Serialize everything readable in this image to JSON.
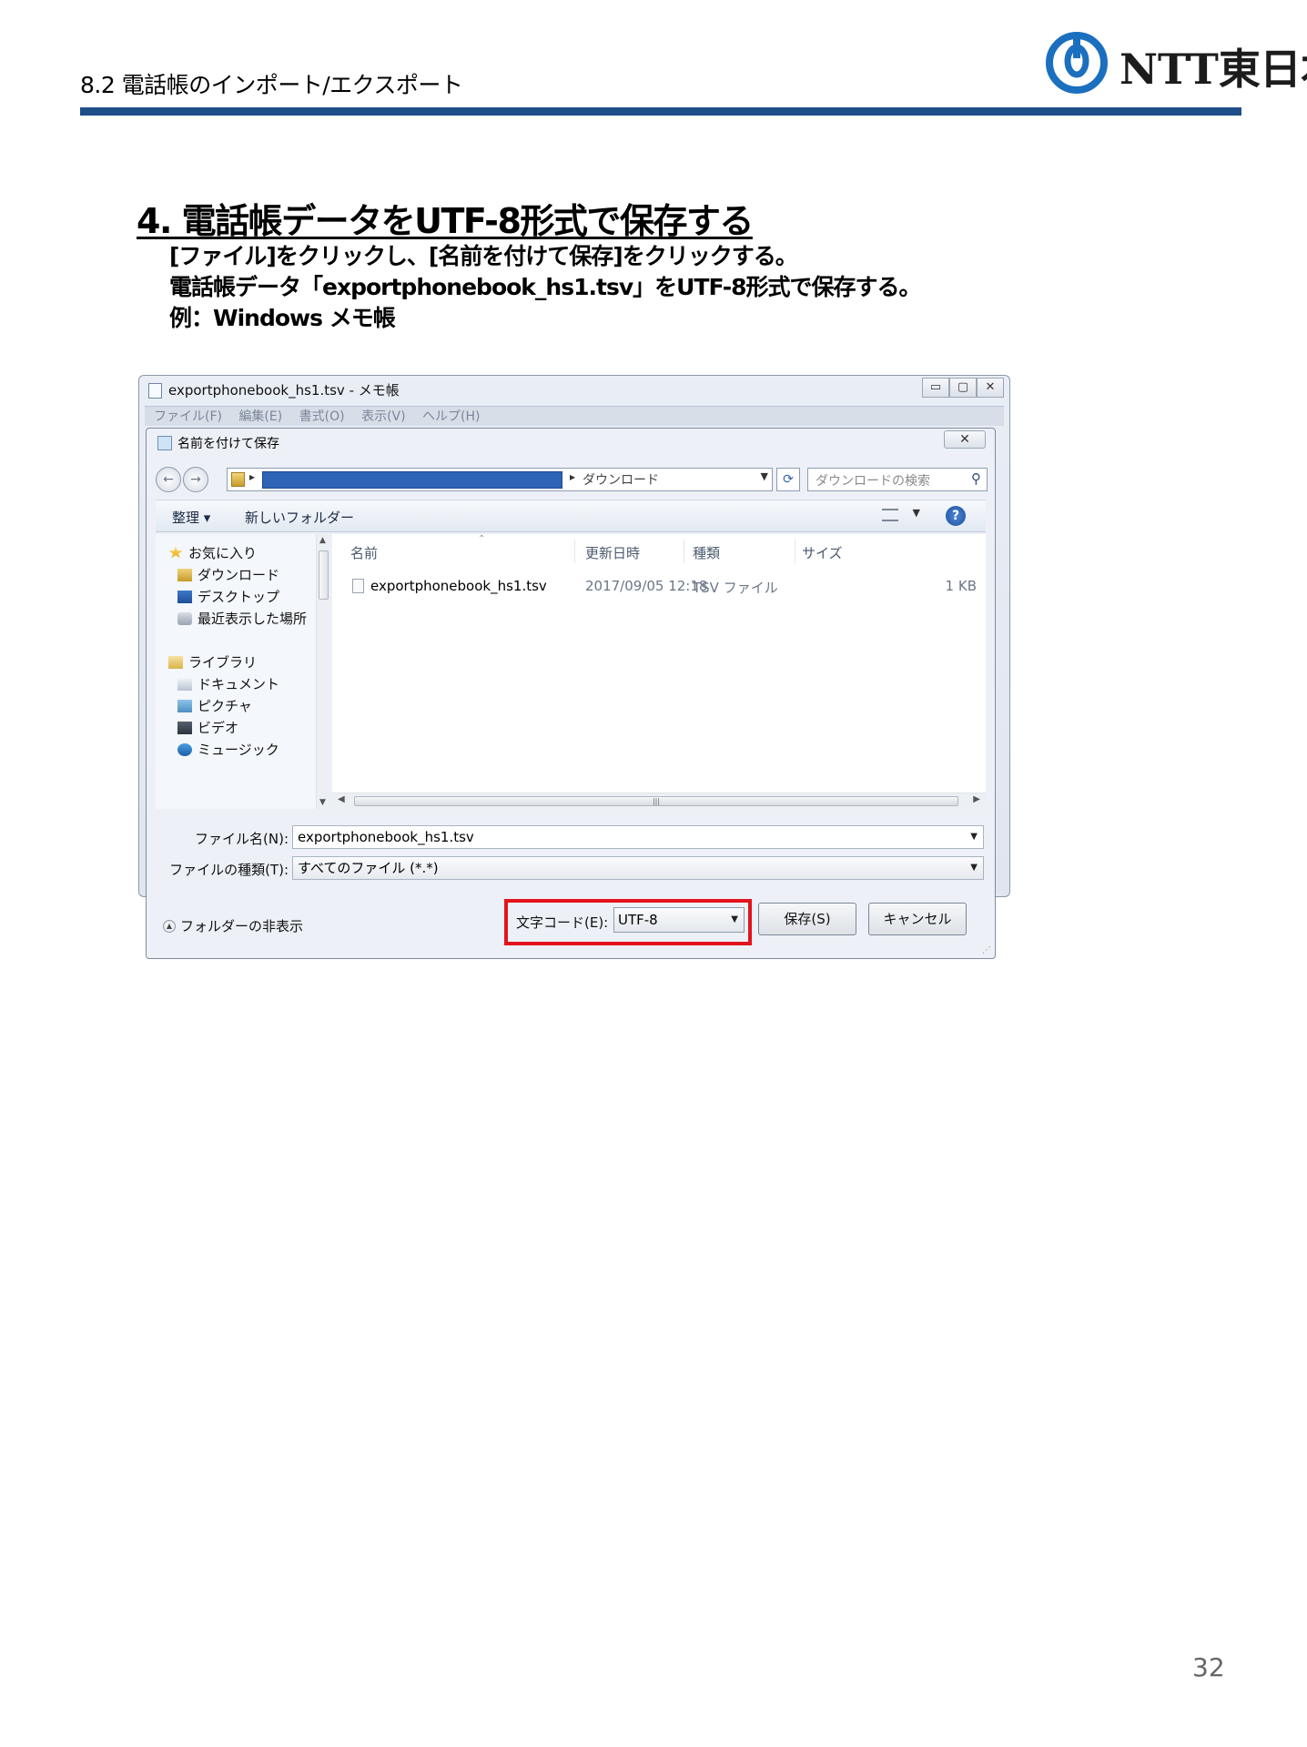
{
  "header": {
    "section_title": "8.2 電話帳のインポート/エクスポート",
    "logo_text_latin": "NTT",
    "logo_text_jp": "東日本",
    "bar_color": "#1f4e89"
  },
  "step": {
    "heading": "4. 電話帳データをUTF-8形式で保存する",
    "line1": "[ファイル]をクリックし、[名前を付けて保存]をクリックする。",
    "line2": "電話帳データ「exportphonebook_hs1.tsv」をUTF-8形式で保存する。",
    "line3": "例：Windows メモ帳"
  },
  "notepad": {
    "title": "exportphonebook_hs1.tsv - メモ帳",
    "menu": [
      "ファイル(F)",
      "編集(E)",
      "書式(O)",
      "表示(V)",
      "ヘルプ(H)"
    ],
    "controls": [
      "minimize-icon",
      "maximize-icon",
      "close-icon"
    ]
  },
  "dialog": {
    "title": "名前を付けて保存",
    "address_current": "ダウンロード",
    "search_placeholder": "ダウンロードの検索",
    "toolbar": {
      "organize": "整理 ▾",
      "new_folder": "新しいフォルダー"
    },
    "nav": {
      "favorites": "お気に入り",
      "downloads": "ダウンロード",
      "desktop": "デスクトップ",
      "recent": "最近表示した場所",
      "libraries": "ライブラリ",
      "documents": "ドキュメント",
      "pictures": "ピクチャ",
      "videos": "ビデオ",
      "music": "ミュージック"
    },
    "columns": {
      "name": "名前",
      "modified": "更新日時",
      "type": "種類",
      "size": "サイズ"
    },
    "files": [
      {
        "name": "exportphonebook_hs1.tsv",
        "modified": "2017/09/05 12:18",
        "type": "TSV ファイル",
        "size": "1 KB"
      }
    ],
    "filename_label": "ファイル名(N):",
    "filename_value": "exportphonebook_hs1.tsv",
    "filetype_label": "ファイルの種類(T):",
    "filetype_value": "すべてのファイル (*.*)",
    "hide_folders": "フォルダーの非表示",
    "encoding_label": "文字コード(E):",
    "encoding_value": "UTF-8",
    "save_button": "保存(S)",
    "cancel_button": "キャンセル",
    "highlight_color": "#e3141c"
  },
  "page_number": "32"
}
